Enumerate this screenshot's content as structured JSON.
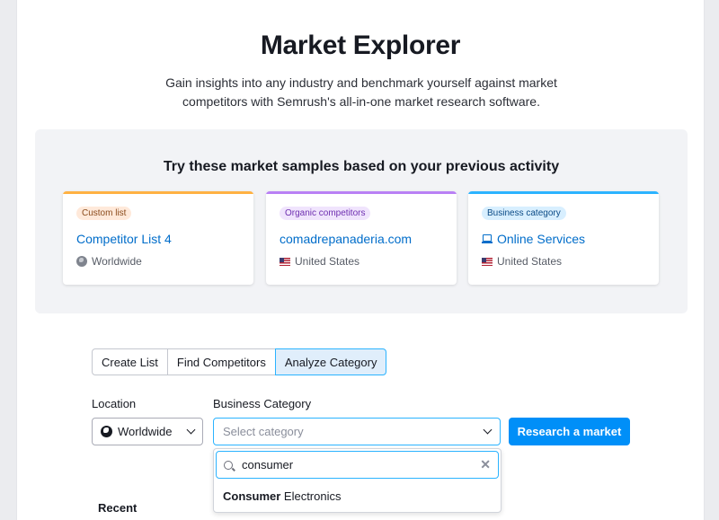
{
  "header": {
    "title": "Market Explorer",
    "subtitle": "Gain insights into any industry and benchmark yourself against market competitors with Semrush's all-in-one market research software."
  },
  "samples": {
    "heading": "Try these market samples based on your previous activity",
    "cards": [
      {
        "badge": "Custom list",
        "name": "Competitor List 4",
        "location": "Worldwide",
        "accent": "#ffb142",
        "badge_bg": "#ffe9da",
        "badge_color": "#8a4b1c",
        "location_icon": "globe-icon",
        "name_icon": ""
      },
      {
        "badge": "Organic competitors",
        "name": "comadrepanaderia.com",
        "location": "United States",
        "accent": "#b980f5",
        "badge_bg": "#f0e4fd",
        "badge_color": "#6e2fb0",
        "location_icon": "us-flag-icon",
        "name_icon": ""
      },
      {
        "badge": "Business category",
        "name": "Online Services",
        "location": "United States",
        "accent": "#2bb3ff",
        "badge_bg": "#d8efff",
        "badge_color": "#0a4a85",
        "location_icon": "us-flag-icon",
        "name_icon": "laptop-icon"
      }
    ]
  },
  "tabs": [
    "Create List",
    "Find Competitors",
    "Analyze Category"
  ],
  "active_tab": "Analyze Category",
  "form": {
    "location_label": "Location",
    "location_value": "Worldwide",
    "category_label": "Business Category",
    "category_placeholder": "Select category",
    "research_button": "Research a market",
    "search_value": "consumer",
    "option_match": "Consumer",
    "option_rest": " Electronics"
  },
  "recent_label": "Recent",
  "colors": {
    "primary": "#008ff8",
    "link": "#006dca",
    "active_tab_bg": "#e0eefb",
    "focus": "#2bb3ff"
  }
}
